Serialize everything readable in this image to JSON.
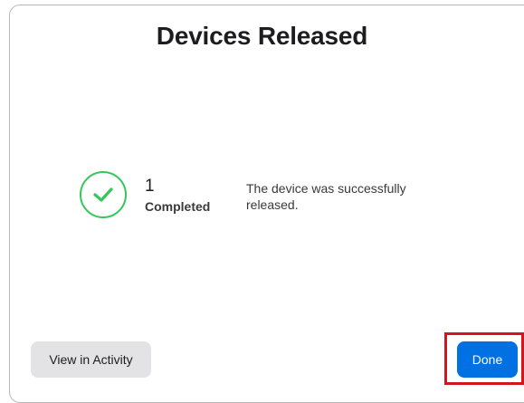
{
  "dialog": {
    "title": "Devices Released"
  },
  "result": {
    "icon": "checkmark-circle-icon",
    "icon_color": "#34c759",
    "count": "1",
    "count_label": "Completed",
    "message": "The device was successfully released."
  },
  "buttons": {
    "view_activity_label": "View in Activity",
    "done_label": "Done",
    "done_color": "#0071e3"
  },
  "highlight_color": "#d2151f"
}
